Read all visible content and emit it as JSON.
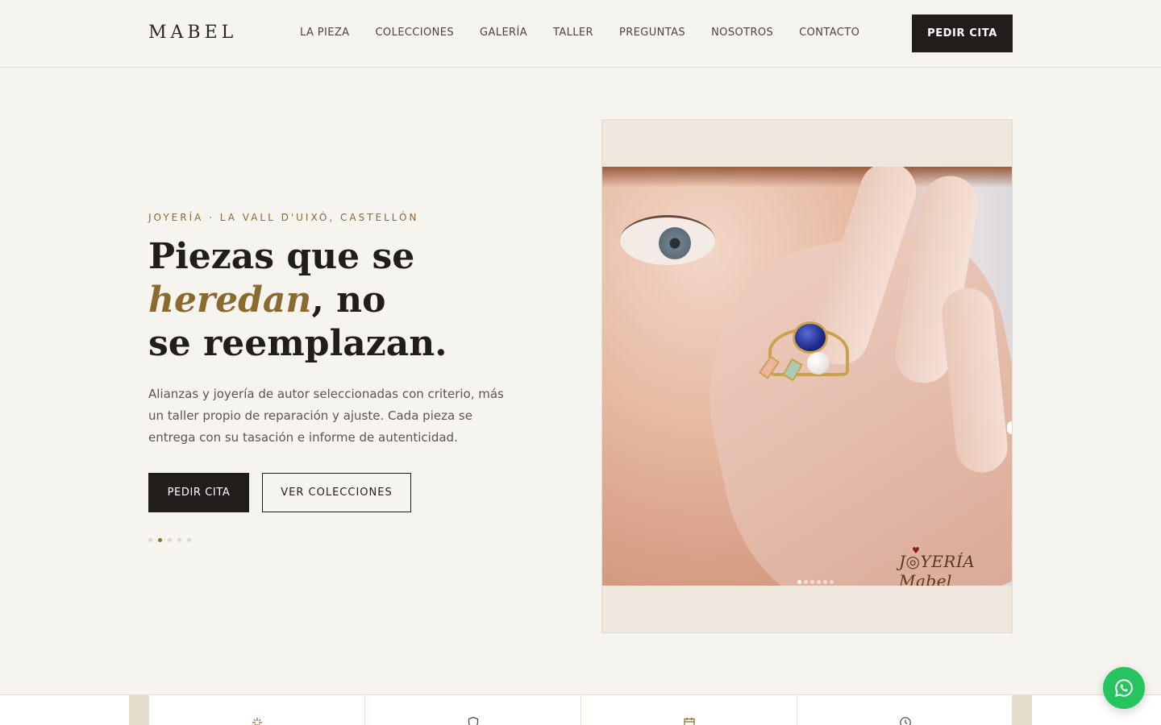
{
  "brand": {
    "logo": "MABEL",
    "accent_color": "#8a6a2e",
    "dark_color": "#221d1b"
  },
  "nav": {
    "items": [
      "LA PIEZA",
      "COLECCIONES",
      "GALERÍA",
      "TALLER",
      "PREGUNTAS",
      "NOSOTROS",
      "CONTACTO"
    ],
    "cta_label": "PEDIR CITA"
  },
  "hero": {
    "eyebrow": "JOYERÍA · LA VALL D'UIXÓ, CASTELLÓN",
    "headline_part1": "Piezas que se",
    "headline_em": "heredan",
    "headline_part2": ", no",
    "headline_part3": "se reemplazan.",
    "lead": "Alianzas y joyería de autor seleccionadas con criterio, más un taller propio de reparación y ajuste. Cada pieza se entrega con su tasación e informe de autenticidad.",
    "primary_label": "PEDIR CITA",
    "secondary_label": "VER COLECCIONES",
    "slides_total": 5,
    "slide_active": 2
  },
  "hero_image": {
    "watermark_prefix": "J",
    "watermark_mid": "YERÍA",
    "watermark_script": "Mabel",
    "dots_total": 6,
    "dot_active": 1
  },
  "feature_icons": [
    "sparkle-icon",
    "shield-icon",
    "calendar-icon",
    "clock-icon"
  ],
  "whatsapp": {
    "icon": "whatsapp-icon",
    "color": "#25c45f"
  }
}
